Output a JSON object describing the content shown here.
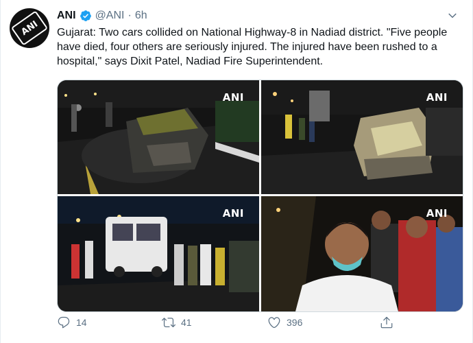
{
  "account": {
    "name": "ANI",
    "handle": "@ANI",
    "separator": "·",
    "time": "6h",
    "avatar_logo_text": "ANI"
  },
  "tweet": {
    "text": "Gujarat: Two cars collided on National Highway-8 in Nadiad district. \"Five people have died, four others are seriously injured. The injured have been rushed to a hospital,\" says Dixit Patel, Nadiad Fire Superintendent."
  },
  "media": {
    "watermark": "ANI",
    "photo_count": 4
  },
  "actions": {
    "replies": "14",
    "retweets": "41",
    "likes": "396"
  },
  "colors": {
    "verified_blue": "#1da1f2",
    "secondary_text": "#5b7083"
  },
  "icons": [
    "verified-badge-icon",
    "caret-down-icon",
    "reply-icon",
    "retweet-icon",
    "like-icon",
    "share-icon"
  ]
}
